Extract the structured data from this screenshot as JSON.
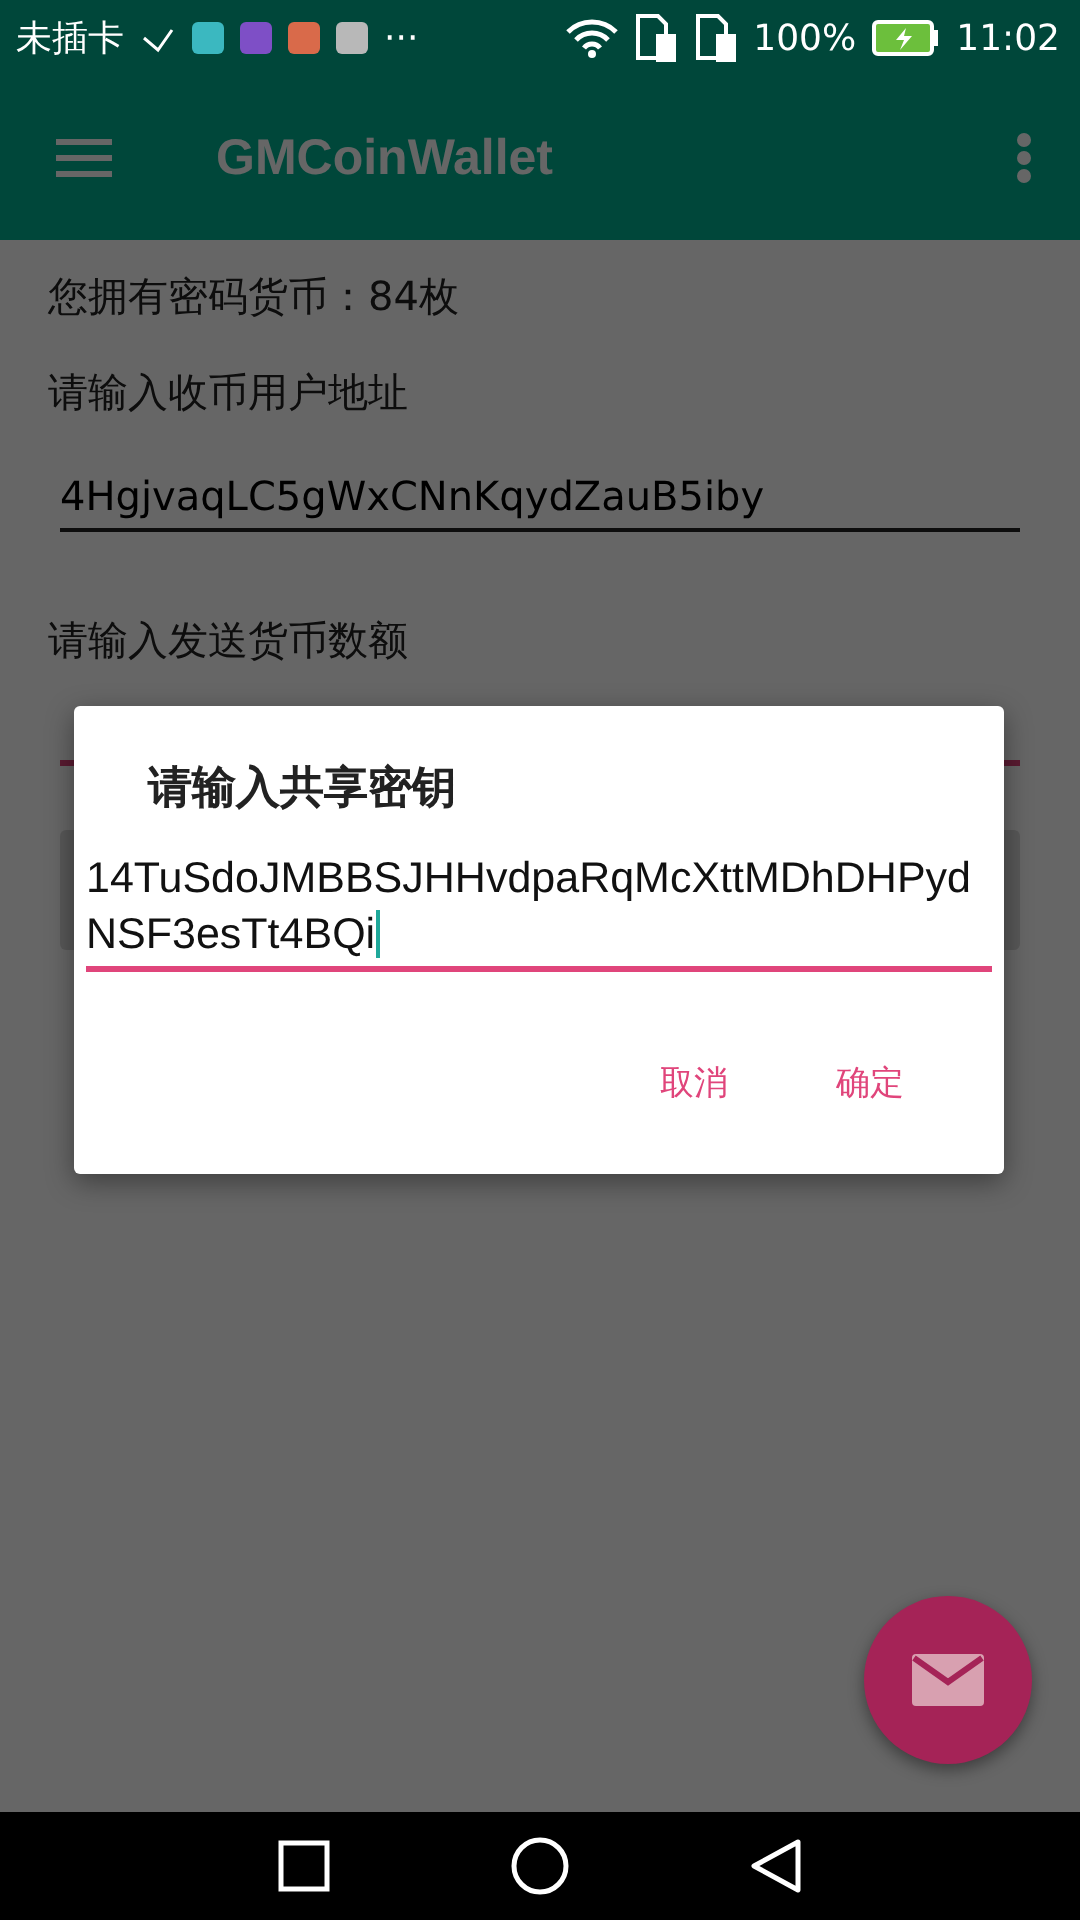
{
  "status_bar": {
    "carrier": "未插卡",
    "more_text": "···",
    "battery": "100%",
    "time": "11:02"
  },
  "toolbar": {
    "title": "GMCoinWallet"
  },
  "balance": "您拥有密码货币：84枚",
  "address": {
    "label": "请输入收币用户地址",
    "value": "4HgjvaqLC5gWxCNnKqydZauB5iby"
  },
  "amount": {
    "label": "请输入发送货币数额"
  },
  "dialog": {
    "title": "请输入共享密钥",
    "value": "14TuSdoJMBBSJHHvdpaRqMcXttMDhDHPydNSF3esTt4BQi",
    "buttons": [
      "取消",
      "确定"
    ]
  }
}
